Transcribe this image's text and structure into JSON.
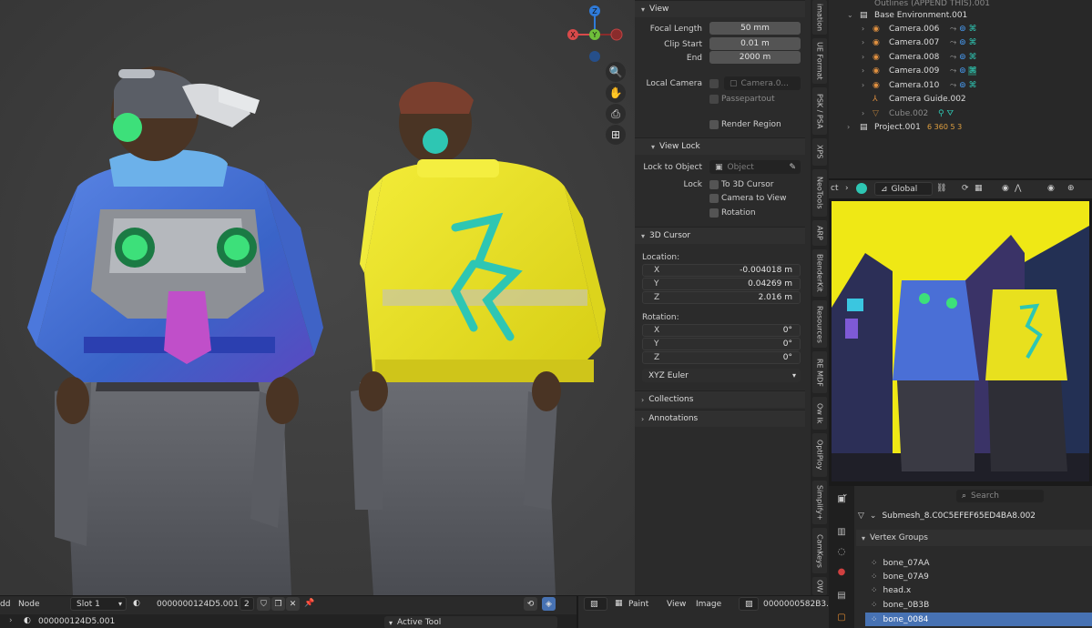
{
  "view_panel": {
    "header": "View",
    "focal_length_label": "Focal Length",
    "focal_length": "50 mm",
    "clip_start_label": "Clip Start",
    "clip_start": "0.01 m",
    "end_label": "End",
    "end": "2000 m",
    "local_camera_label": "Local Camera",
    "local_camera_value": "Camera.0...",
    "passepartout_label": "Passepartout",
    "render_region_label": "Render Region"
  },
  "view_lock": {
    "header": "View Lock",
    "lock_to_object_label": "Lock to Object",
    "object_placeholder": "Object",
    "lock_label": "Lock",
    "to_3d_cursor_label": "To 3D Cursor",
    "camera_to_view_label": "Camera to View",
    "rotation_label": "Rotation"
  },
  "cursor_panel": {
    "header": "3D Cursor",
    "location_label": "Location:",
    "location": [
      {
        "axis": "X",
        "value": "-0.004018 m"
      },
      {
        "axis": "Y",
        "value": "0.04269 m"
      },
      {
        "axis": "Z",
        "value": "2.016 m"
      }
    ],
    "rotation_label": "Rotation:",
    "rotation": [
      {
        "axis": "X",
        "value": "0°"
      },
      {
        "axis": "Y",
        "value": "0°"
      },
      {
        "axis": "Z",
        "value": "0°"
      }
    ],
    "rotation_mode": "XYZ Euler"
  },
  "collapsed_panels": [
    "Collections",
    "Annotations"
  ],
  "side_tabs": [
    "imation",
    "UE Format",
    "PSK / PSA",
    "XPS",
    "NeoTools",
    "ARP",
    "BlenderKit",
    "Resources",
    "RE MDF",
    "Ow Ik",
    "OptiPloy",
    "Simplify+",
    "CamKeys",
    "OW"
  ],
  "outliner": {
    "rows": [
      {
        "name": "Outlines (APPEND THIS).001",
        "icon": "collection-icon",
        "dim": true
      },
      {
        "name": "Base Environment.001",
        "icon": "collection-icon",
        "dim": false
      },
      {
        "name": "Camera.006",
        "icon": "camera-icon",
        "dim": false
      },
      {
        "name": "Camera.007",
        "icon": "camera-icon",
        "dim": false
      },
      {
        "name": "Camera.008",
        "icon": "camera-icon",
        "dim": false
      },
      {
        "name": "Camera.009",
        "icon": "camera-icon",
        "dim": false
      },
      {
        "name": "Camera.010",
        "icon": "camera-icon",
        "dim": false
      },
      {
        "name": "Camera Guide.002",
        "icon": "empty-icon",
        "dim": false
      },
      {
        "name": "Cube.002",
        "icon": "mesh-icon",
        "dim": true
      },
      {
        "name": "Project.001",
        "icon": "collection-icon",
        "dim": false
      }
    ],
    "project_extra": "6 360 5 3"
  },
  "preview": {
    "orientation": "Global"
  },
  "properties": {
    "search_placeholder": "Search",
    "mesh_name": "Submesh_8.C0C5EFEF65ED4BA8.002",
    "vertex_groups_header": "Vertex Groups",
    "vertex_groups": [
      "bone_07AA",
      "bone_07A9",
      "head.x",
      "bone_0B3B",
      "bone_0084"
    ],
    "selected_index": 4
  },
  "bottom_bar": {
    "add_label": "dd",
    "node_label": "Node",
    "slot": "Slot 1",
    "material_name": "0000000124D5.001",
    "user_count": "2",
    "paint_label": "Paint",
    "view_label": "View",
    "image_label": "Image",
    "image_name": "0000000582B3.",
    "active_tool_label": "Active Tool",
    "node_path": "000000124D5.001"
  },
  "colors": {
    "selection": "#4772b3",
    "jacket_yellow": "#e8e01e",
    "jacket_blue": "#3f6fd2",
    "neon_green": "#3de07a",
    "accent_teal": "#2ec6b3"
  }
}
